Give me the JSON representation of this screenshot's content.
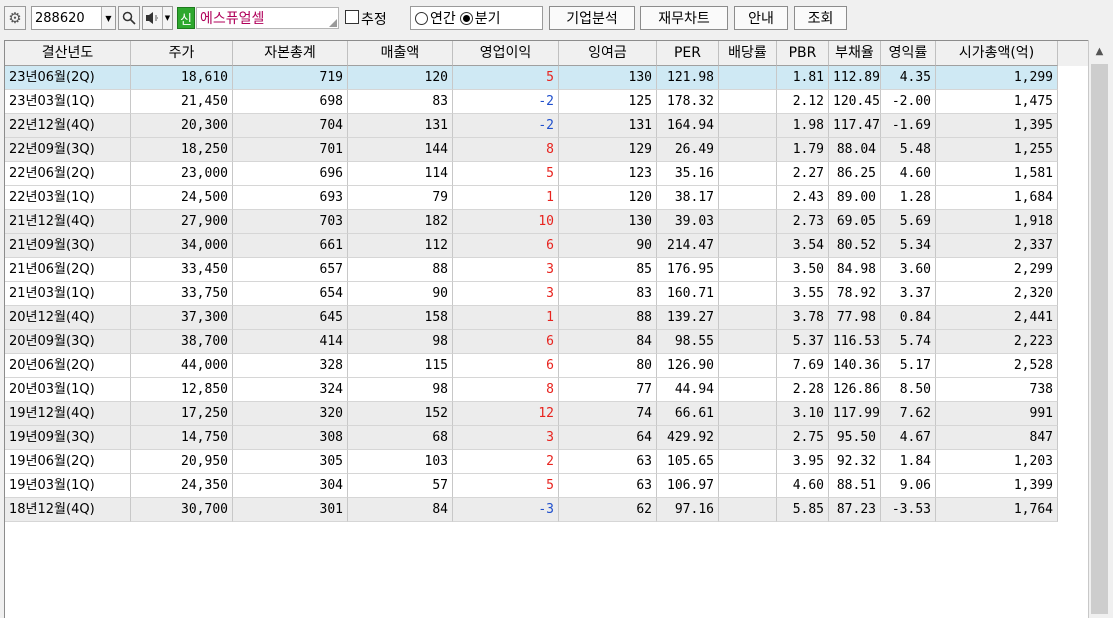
{
  "toolbar": {
    "settings_icon": "gear-icon",
    "stock_code": "288620",
    "search_icon": "search-icon",
    "sound_icon": "speaker-icon",
    "badge": "신",
    "company_name": "에스퓨얼셀",
    "estimate_label": "추정",
    "estimate_checked": false,
    "annual_label": "연간",
    "quarterly_label": "분기",
    "period_selected": "분기",
    "btn_corp_analysis": "기업분석",
    "btn_fin_chart": "재무차트",
    "btn_guide": "안내",
    "btn_query": "조회"
  },
  "table": {
    "headers": [
      "결산년도",
      "주가",
      "자본총계",
      "매출액",
      "영업이익",
      "잉여금",
      "PER",
      "배당률",
      "PBR",
      "부채율",
      "영익률",
      "시가총액(억)"
    ],
    "rows": [
      [
        "23년06월(2Q)",
        "18,610",
        "719",
        "120",
        "5",
        "130",
        "121.98",
        "",
        "1.81",
        "112.89",
        "4.35",
        "1,299"
      ],
      [
        "23년03월(1Q)",
        "21,450",
        "698",
        "83",
        "-2",
        "125",
        "178.32",
        "",
        "2.12",
        "120.45",
        "-2.00",
        "1,475"
      ],
      [
        "22년12월(4Q)",
        "20,300",
        "704",
        "131",
        "-2",
        "131",
        "164.94",
        "",
        "1.98",
        "117.47",
        "-1.69",
        "1,395"
      ],
      [
        "22년09월(3Q)",
        "18,250",
        "701",
        "144",
        "8",
        "129",
        "26.49",
        "",
        "1.79",
        "88.04",
        "5.48",
        "1,255"
      ],
      [
        "22년06월(2Q)",
        "23,000",
        "696",
        "114",
        "5",
        "123",
        "35.16",
        "",
        "2.27",
        "86.25",
        "4.60",
        "1,581"
      ],
      [
        "22년03월(1Q)",
        "24,500",
        "693",
        "79",
        "1",
        "120",
        "38.17",
        "",
        "2.43",
        "89.00",
        "1.28",
        "1,684"
      ],
      [
        "21년12월(4Q)",
        "27,900",
        "703",
        "182",
        "10",
        "130",
        "39.03",
        "",
        "2.73",
        "69.05",
        "5.69",
        "1,918"
      ],
      [
        "21년09월(3Q)",
        "34,000",
        "661",
        "112",
        "6",
        "90",
        "214.47",
        "",
        "3.54",
        "80.52",
        "5.34",
        "2,337"
      ],
      [
        "21년06월(2Q)",
        "33,450",
        "657",
        "88",
        "3",
        "85",
        "176.95",
        "",
        "3.50",
        "84.98",
        "3.60",
        "2,299"
      ],
      [
        "21년03월(1Q)",
        "33,750",
        "654",
        "90",
        "3",
        "83",
        "160.71",
        "",
        "3.55",
        "78.92",
        "3.37",
        "2,320"
      ],
      [
        "20년12월(4Q)",
        "37,300",
        "645",
        "158",
        "1",
        "88",
        "139.27",
        "",
        "3.78",
        "77.98",
        "0.84",
        "2,441"
      ],
      [
        "20년09월(3Q)",
        "38,700",
        "414",
        "98",
        "6",
        "84",
        "98.55",
        "",
        "5.37",
        "116.53",
        "5.74",
        "2,223"
      ],
      [
        "20년06월(2Q)",
        "44,000",
        "328",
        "115",
        "6",
        "80",
        "126.90",
        "",
        "7.69",
        "140.36",
        "5.17",
        "2,528"
      ],
      [
        "20년03월(1Q)",
        "12,850",
        "324",
        "98",
        "8",
        "77",
        "44.94",
        "",
        "2.28",
        "126.86",
        "8.50",
        "738"
      ],
      [
        "19년12월(4Q)",
        "17,250",
        "320",
        "152",
        "12",
        "74",
        "66.61",
        "",
        "3.10",
        "117.99",
        "7.62",
        "991"
      ],
      [
        "19년09월(3Q)",
        "14,750",
        "308",
        "68",
        "3",
        "64",
        "429.92",
        "",
        "2.75",
        "95.50",
        "4.67",
        "847"
      ],
      [
        "19년06월(2Q)",
        "20,950",
        "305",
        "103",
        "2",
        "63",
        "105.65",
        "",
        "3.95",
        "92.32",
        "1.84",
        "1,203"
      ],
      [
        "19년03월(1Q)",
        "24,350",
        "304",
        "57",
        "5",
        "63",
        "106.97",
        "",
        "4.60",
        "88.51",
        "9.06",
        "1,399"
      ],
      [
        "18년12월(4Q)",
        "30,700",
        "301",
        "84",
        "-3",
        "62",
        "97.16",
        "",
        "5.85",
        "87.23",
        "-3.53",
        "1,764"
      ]
    ],
    "selected_row": 0
  },
  "colors": {
    "positive": "#e8231e",
    "negative": "#1f4fcc",
    "selected_row": "#cfe9f4",
    "badge": "#2ea82e",
    "company_name": "#b0005a"
  }
}
